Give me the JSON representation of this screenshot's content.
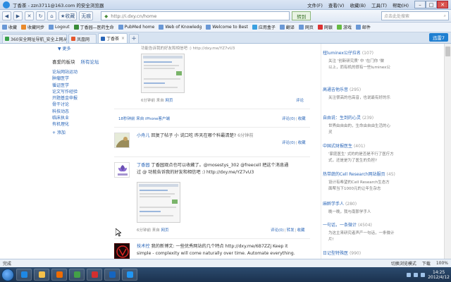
{
  "window": {
    "title": "丁香茶 - zzn3711@163.com 的安全浏览器",
    "menu": [
      "文件(F)",
      "查看(V)",
      "收藏(B)",
      "工具(T)",
      "帮助(H)"
    ]
  },
  "toolbar": {
    "back": "◀",
    "forward": "▶",
    "close": "✕",
    "refresh": "↻",
    "home": "⌂",
    "favorites_label": "收藏",
    "tracking_label": "无痕",
    "url": "http://i.dxy.cn/home",
    "go_label": "转到",
    "search_placeholder": "点击此处搜索"
  },
  "favorites": [
    "收藏",
    "收藏同步",
    "Logout",
    "丁香园—医药生命",
    "PubMed home",
    "Web of Knowledg",
    "Welcome to Best",
    "应用盒子",
    "翻译",
    "网页",
    "网银",
    "游戏",
    "邮件"
  ],
  "tabs": [
    {
      "label": "360安全网址导航_安全上网从360开始",
      "active": false
    },
    {
      "label": "凤凰网",
      "active": false
    },
    {
      "label": "丁香茶",
      "active": true
    }
  ],
  "xunlei_label": "迅雷7",
  "left": {
    "more": "▼ 更多",
    "section_title": "喜爱的板块",
    "section_link": "所有论坛",
    "items": [
      "论坛网站运动",
      "肿瘤医学",
      "循证医学",
      "论文写作经验",
      "开题基金申报",
      "骨干讨论",
      "科技动态",
      "临床执业",
      "有机理化"
    ],
    "add": "+ 添加"
  },
  "feed": {
    "top_line": "功能告诉我的好友和相信吧 :) http://dxy.me/YZ7vU3",
    "post1_tools": {
      "time": "6分钟前",
      "source_label": "来自",
      "source": "网页"
    },
    "post1_actions": {
      "forward": "转发",
      "comment": "评论",
      "favorite": "收藏"
    },
    "post2_meta": {
      "text": "18秒钟前 来自 iPhone客户端"
    },
    "post2_actions": {
      "forward": "评论(0)",
      "favorite": "收藏"
    },
    "post3": {
      "user": "小舟儿",
      "text": "回复了帖子 小 说口吃 昨天在哪个科最清楚?",
      "time": "6分钟前"
    },
    "post3_actions": {
      "forward": "评论(0)",
      "favorite": "收藏"
    },
    "post4": {
      "user": "丁香园",
      "line1": "丁香园观点也可以收藏了。@mosestys_302 @freecell 把这个消息通",
      "line2": "过 @ 功能告诉我的好友和相信吧 :) http://dxy.me/YZ7vU3"
    },
    "post4_tools": {
      "time": "6分钟前",
      "source_label": "来自",
      "source": "网页"
    },
    "post4_actions": {
      "forward": "评论(0)",
      "comment": "转发",
      "favorite": "收藏"
    },
    "post5": {
      "user": "技术控",
      "line1": "我的新博文: 一些优秀网站的几个特点 http://dxy.me/6B7ZZj Keep it",
      "line2": "simple - complexity will come naturally over time. Automate everything."
    }
  },
  "groups": [
    {
      "name": "扭luminex公仔拉名",
      "count": "(107)",
      "desc": [
        "关注 '创新研究质' 中 '在门你 '做",
        "以上，而有机的很有一些luminex公"
      ]
    },
    {
      "name": "高通吉他乐音",
      "count": "(295)",
      "desc": [
        "关注很高的也高音，也说最有好的乐"
      ]
    },
    {
      "name": "自由说：生到的心灵",
      "count": "(239)",
      "desc": [
        "世界由自由的，生命由自由生活的心",
        "灵"
      ]
    },
    {
      "name": "中国式财报医生",
      "count": "(401)",
      "desc": [
        "'家庭医生' 式的的是否是不行了医疗方",
        "式，还是是为了医生的负担?"
      ]
    },
    {
      "name": "热带蔬的Cell Research网站服页",
      "count": "(45)",
      "desc": [
        "设计有希望的Cell Research生态方",
        "面帮当下1000元的让年生杂志"
      ]
    },
    {
      "name": "麻醉学手人",
      "count": "(280)",
      "desc": [
        "晚一晚，我与南那学手人"
      ]
    },
    {
      "name": "一句话，一条微计",
      "count": "(4504)",
      "desc": [
        "为这主来研究者声产一句话，一条微计",
        "片!"
      ]
    },
    {
      "name": "日记型特殊医",
      "count": "(990)",
      "desc": []
    }
  ],
  "statusbar": {
    "left": "完成",
    "items": [
      "切换浏览模式",
      "下载",
      "100%"
    ]
  },
  "taskbar": {
    "time": "14:25",
    "date": "2012/4/12",
    "icons": [
      {
        "name": "ie-icon",
        "color": "#1e88e5"
      },
      {
        "name": "folder-icon",
        "color": "#f5c04a"
      },
      {
        "name": "player-icon",
        "color": "#ef6c00"
      },
      {
        "name": "browser-360-icon",
        "color": "#43a047"
      },
      {
        "name": "foxit-icon",
        "color": "#d32f2f"
      },
      {
        "name": "word-icon",
        "color": "#1565c0"
      },
      {
        "name": "thunder-icon",
        "color": "#2196f3"
      }
    ]
  }
}
